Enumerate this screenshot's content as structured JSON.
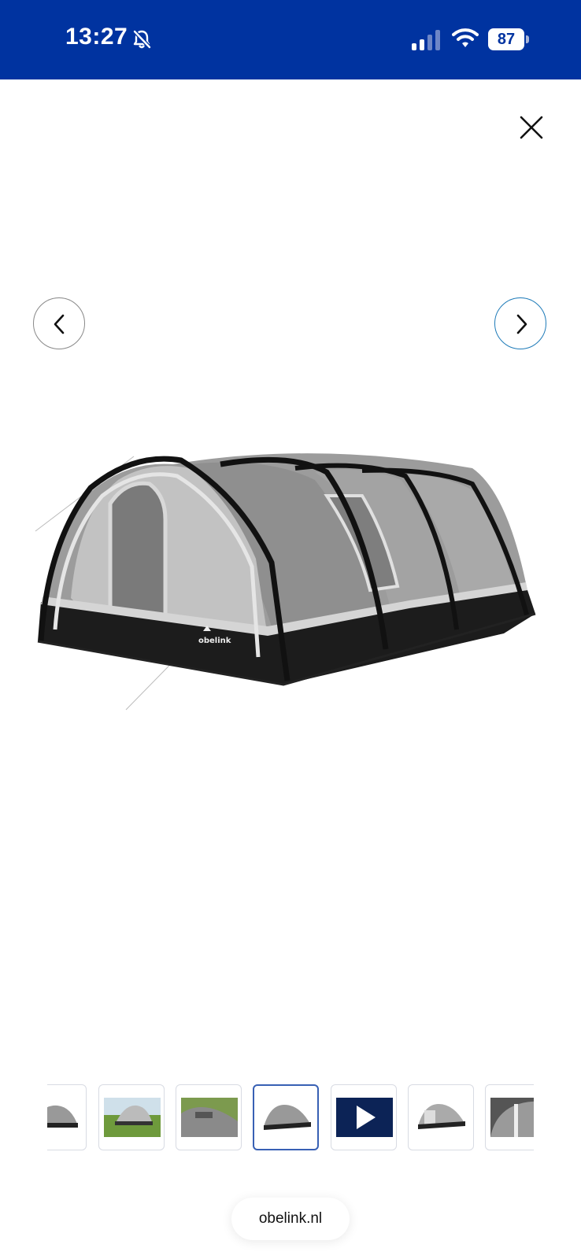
{
  "status_bar": {
    "time": "13:27",
    "battery_percent": "87",
    "battery_level": 0.87,
    "icons": [
      "bell-slash-icon",
      "cellular-signal-icon",
      "wifi-icon",
      "battery-icon"
    ],
    "background_color": "#0033a0"
  },
  "viewer": {
    "close_icon": "close-icon",
    "prev_icon": "chevron-left-icon",
    "next_icon": "chevron-right-icon",
    "main_image": "tent-product-photo",
    "thumbnail_count": 7,
    "active_thumbnail_index": 3,
    "thumbnails": [
      "tent-side-view",
      "tent-campsite-photo",
      "tent-roof-closeup",
      "tent-product-photo",
      "video-thumbnail",
      "tent-open-door",
      "tent-interior"
    ]
  },
  "browser": {
    "domain": "obelink.nl"
  },
  "colors": {
    "accent": "#3860b4",
    "next_button_border": "#1d7ab8"
  }
}
